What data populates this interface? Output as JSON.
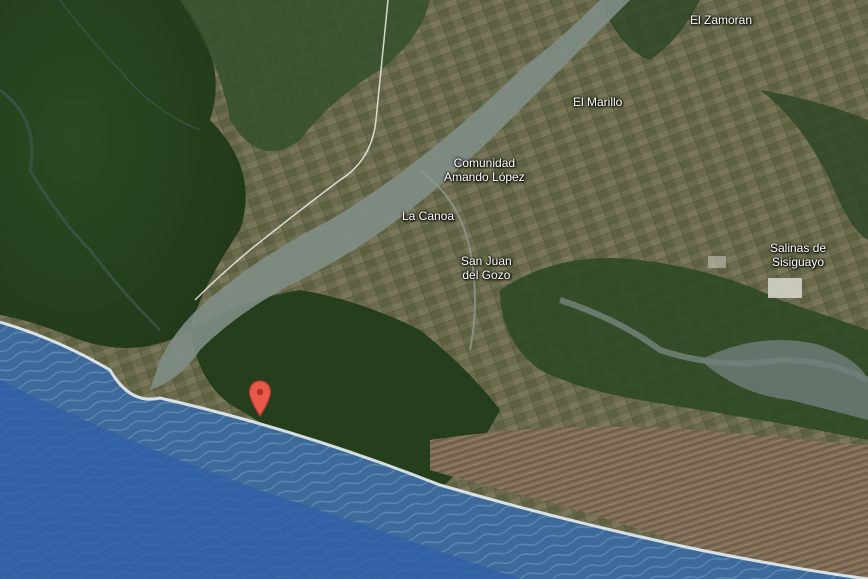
{
  "map": {
    "view": "satellite",
    "colors": {
      "ocean": "#2f5fa8",
      "surf": "#e8eef0",
      "vegetation": "#2e4a22",
      "farmland": "#6b6a4c",
      "river": "#7d8c88",
      "marker": "#e8594a"
    },
    "places": {
      "el_zamoran": {
        "lines": [
          "El Zamoran"
        ]
      },
      "el_marillo": {
        "lines": [
          "El Marillo"
        ]
      },
      "comunidad_amando_lopez": {
        "lines": [
          "Comunidad",
          "Amando López"
        ]
      },
      "la_canoa": {
        "lines": [
          "La Canoa"
        ]
      },
      "san_juan_del_gozo": {
        "lines": [
          "San Juan",
          "del Gozo"
        ]
      },
      "salinas_de_sisiguayo": {
        "lines": [
          "Salinas de",
          "Sisiguayo"
        ]
      }
    },
    "marker": {
      "icon": "map-pin-icon"
    }
  }
}
